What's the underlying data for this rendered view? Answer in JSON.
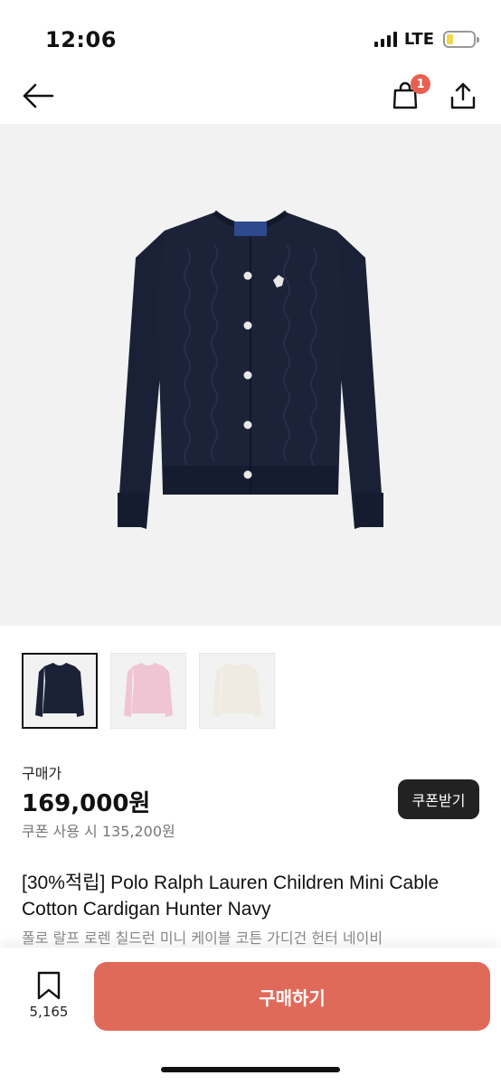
{
  "status": {
    "time": "12:06",
    "network": "LTE",
    "battery_level": 0.25
  },
  "nav": {
    "back_icon": "arrow-left-icon",
    "cart_icon": "shopping-bag-icon",
    "cart_count": "1",
    "share_icon": "share-icon"
  },
  "product": {
    "image_alt": "navy cable knit cardigan",
    "thumbnails": [
      {
        "color": "#1b2238",
        "label": "navy"
      },
      {
        "color": "#efc5d3",
        "label": "pink"
      },
      {
        "color": "#efebe3",
        "label": "cream"
      }
    ],
    "selected_thumbnail": 0,
    "price_label": "구매가",
    "price": "169,000원",
    "coupon_price": "쿠폰 사용 시 135,200원",
    "coupon_button": "쿠폰받기",
    "title": "[30%적립] Polo Ralph Lauren Children Mini Cable Cotton Cardigan Hunter Navy",
    "subtitle": "폴로 랄프 로렌 칠드런 미니 케이블 코튼 가디건 헌터 네이비"
  },
  "bottom": {
    "bookmark_count": "5,165",
    "buy_label": "구매하기"
  },
  "colors": {
    "accent": "#e06a5a",
    "badge": "#e8604f",
    "dark_button": "#222222",
    "battery": "#f2d64b",
    "hero_bg": "#f2f2f2",
    "garment": "#1b2238"
  }
}
